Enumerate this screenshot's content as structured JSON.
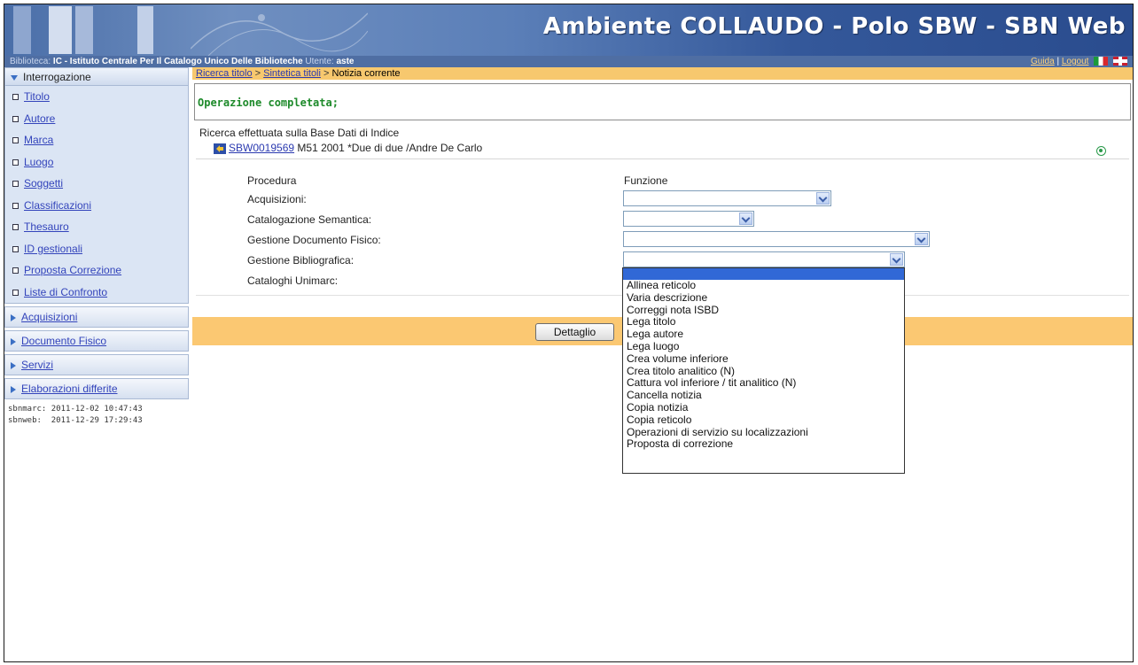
{
  "header": {
    "title": "Ambiente COLLAUDO - Polo SBW - SBN Web"
  },
  "infobar": {
    "library_label": "Biblioteca:",
    "library_code": "IC",
    "library_name": "- Istituto Centrale Per Il Catalogo Unico Delle Biblioteche",
    "user_label": "Utente:",
    "user_name": "aste",
    "help_link": "Guida",
    "separator": "|",
    "logout_link": "Logout"
  },
  "sidebar": {
    "section_title": "Interrogazione",
    "items": [
      {
        "label": "Titolo"
      },
      {
        "label": "Autore"
      },
      {
        "label": "Marca"
      },
      {
        "label": "Luogo"
      },
      {
        "label": "Soggetti"
      },
      {
        "label": "Classificazioni"
      },
      {
        "label": "Thesauro"
      },
      {
        "label": "ID gestionali"
      },
      {
        "label": "Proposta Correzione"
      },
      {
        "label": "Liste di Confronto"
      }
    ],
    "collapsed_sections": [
      {
        "label": "Acquisizioni"
      },
      {
        "label": "Documento Fisico"
      },
      {
        "label": "Servizi"
      },
      {
        "label": "Elaborazioni differite"
      }
    ],
    "timestamps": [
      "sbnmarc: 2011-12-02 10:47:43",
      "sbnweb:  2011-12-29 17:29:43"
    ]
  },
  "breadcrumb": {
    "item1": "Ricerca titolo",
    "sep": ">",
    "item2": "Sintetica titoli",
    "current": "Notizia corrente"
  },
  "message": "Operazione completata;",
  "search_note": "Ricerca effettuata sulla Base Dati di Indice",
  "record": {
    "id": "SBW0019569",
    "description": "M51 2001 *Due di due /Andre De Carlo"
  },
  "form": {
    "col_procedura": "Procedura",
    "col_funzione": "Funzione",
    "rows": [
      {
        "label": "Acquisizioni:",
        "value": ""
      },
      {
        "label": "Catalogazione Semantica:",
        "value": ""
      },
      {
        "label": "Gestione Documento Fisico:",
        "value": ""
      },
      {
        "label": "Gestione Bibliografica:",
        "value": ""
      },
      {
        "label": "Cataloghi Unimarc:",
        "value": ""
      }
    ]
  },
  "dropdown_options": [
    "Allinea reticolo",
    "Varia descrizione",
    "Correggi nota ISBD",
    "Lega titolo",
    "Lega autore",
    "Lega luogo",
    "Crea volume inferiore",
    "Crea titolo analitico (N)",
    "Cattura vol inferiore / tit analitico (N)",
    "Cancella notizia",
    "Copia notizia",
    "Copia reticolo",
    "Operazioni di servizio su localizzazioni",
    "Proposta di correzione"
  ],
  "actions": {
    "detail_button": "Dettaglio"
  }
}
